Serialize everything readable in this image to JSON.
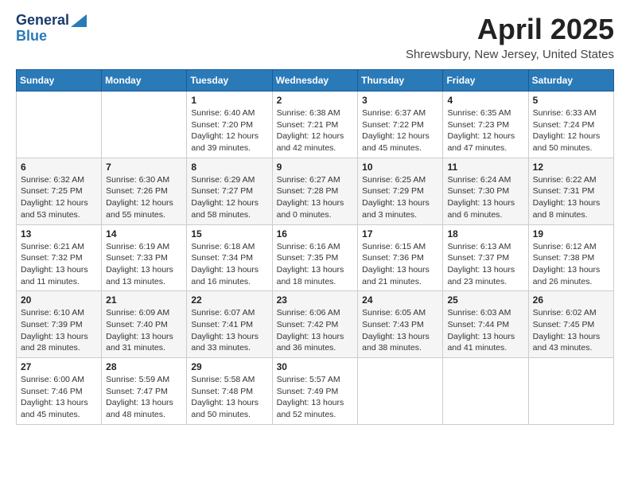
{
  "logo": {
    "line1": "General",
    "line2": "Blue"
  },
  "header": {
    "month": "April 2025",
    "location": "Shrewsbury, New Jersey, United States"
  },
  "weekdays": [
    "Sunday",
    "Monday",
    "Tuesday",
    "Wednesday",
    "Thursday",
    "Friday",
    "Saturday"
  ],
  "weeks": [
    [
      {
        "day": "",
        "info": ""
      },
      {
        "day": "",
        "info": ""
      },
      {
        "day": "1",
        "info": "Sunrise: 6:40 AM\nSunset: 7:20 PM\nDaylight: 12 hours and 39 minutes."
      },
      {
        "day": "2",
        "info": "Sunrise: 6:38 AM\nSunset: 7:21 PM\nDaylight: 12 hours and 42 minutes."
      },
      {
        "day": "3",
        "info": "Sunrise: 6:37 AM\nSunset: 7:22 PM\nDaylight: 12 hours and 45 minutes."
      },
      {
        "day": "4",
        "info": "Sunrise: 6:35 AM\nSunset: 7:23 PM\nDaylight: 12 hours and 47 minutes."
      },
      {
        "day": "5",
        "info": "Sunrise: 6:33 AM\nSunset: 7:24 PM\nDaylight: 12 hours and 50 minutes."
      }
    ],
    [
      {
        "day": "6",
        "info": "Sunrise: 6:32 AM\nSunset: 7:25 PM\nDaylight: 12 hours and 53 minutes."
      },
      {
        "day": "7",
        "info": "Sunrise: 6:30 AM\nSunset: 7:26 PM\nDaylight: 12 hours and 55 minutes."
      },
      {
        "day": "8",
        "info": "Sunrise: 6:29 AM\nSunset: 7:27 PM\nDaylight: 12 hours and 58 minutes."
      },
      {
        "day": "9",
        "info": "Sunrise: 6:27 AM\nSunset: 7:28 PM\nDaylight: 13 hours and 0 minutes."
      },
      {
        "day": "10",
        "info": "Sunrise: 6:25 AM\nSunset: 7:29 PM\nDaylight: 13 hours and 3 minutes."
      },
      {
        "day": "11",
        "info": "Sunrise: 6:24 AM\nSunset: 7:30 PM\nDaylight: 13 hours and 6 minutes."
      },
      {
        "day": "12",
        "info": "Sunrise: 6:22 AM\nSunset: 7:31 PM\nDaylight: 13 hours and 8 minutes."
      }
    ],
    [
      {
        "day": "13",
        "info": "Sunrise: 6:21 AM\nSunset: 7:32 PM\nDaylight: 13 hours and 11 minutes."
      },
      {
        "day": "14",
        "info": "Sunrise: 6:19 AM\nSunset: 7:33 PM\nDaylight: 13 hours and 13 minutes."
      },
      {
        "day": "15",
        "info": "Sunrise: 6:18 AM\nSunset: 7:34 PM\nDaylight: 13 hours and 16 minutes."
      },
      {
        "day": "16",
        "info": "Sunrise: 6:16 AM\nSunset: 7:35 PM\nDaylight: 13 hours and 18 minutes."
      },
      {
        "day": "17",
        "info": "Sunrise: 6:15 AM\nSunset: 7:36 PM\nDaylight: 13 hours and 21 minutes."
      },
      {
        "day": "18",
        "info": "Sunrise: 6:13 AM\nSunset: 7:37 PM\nDaylight: 13 hours and 23 minutes."
      },
      {
        "day": "19",
        "info": "Sunrise: 6:12 AM\nSunset: 7:38 PM\nDaylight: 13 hours and 26 minutes."
      }
    ],
    [
      {
        "day": "20",
        "info": "Sunrise: 6:10 AM\nSunset: 7:39 PM\nDaylight: 13 hours and 28 minutes."
      },
      {
        "day": "21",
        "info": "Sunrise: 6:09 AM\nSunset: 7:40 PM\nDaylight: 13 hours and 31 minutes."
      },
      {
        "day": "22",
        "info": "Sunrise: 6:07 AM\nSunset: 7:41 PM\nDaylight: 13 hours and 33 minutes."
      },
      {
        "day": "23",
        "info": "Sunrise: 6:06 AM\nSunset: 7:42 PM\nDaylight: 13 hours and 36 minutes."
      },
      {
        "day": "24",
        "info": "Sunrise: 6:05 AM\nSunset: 7:43 PM\nDaylight: 13 hours and 38 minutes."
      },
      {
        "day": "25",
        "info": "Sunrise: 6:03 AM\nSunset: 7:44 PM\nDaylight: 13 hours and 41 minutes."
      },
      {
        "day": "26",
        "info": "Sunrise: 6:02 AM\nSunset: 7:45 PM\nDaylight: 13 hours and 43 minutes."
      }
    ],
    [
      {
        "day": "27",
        "info": "Sunrise: 6:00 AM\nSunset: 7:46 PM\nDaylight: 13 hours and 45 minutes."
      },
      {
        "day": "28",
        "info": "Sunrise: 5:59 AM\nSunset: 7:47 PM\nDaylight: 13 hours and 48 minutes."
      },
      {
        "day": "29",
        "info": "Sunrise: 5:58 AM\nSunset: 7:48 PM\nDaylight: 13 hours and 50 minutes."
      },
      {
        "day": "30",
        "info": "Sunrise: 5:57 AM\nSunset: 7:49 PM\nDaylight: 13 hours and 52 minutes."
      },
      {
        "day": "",
        "info": ""
      },
      {
        "day": "",
        "info": ""
      },
      {
        "day": "",
        "info": ""
      }
    ]
  ]
}
